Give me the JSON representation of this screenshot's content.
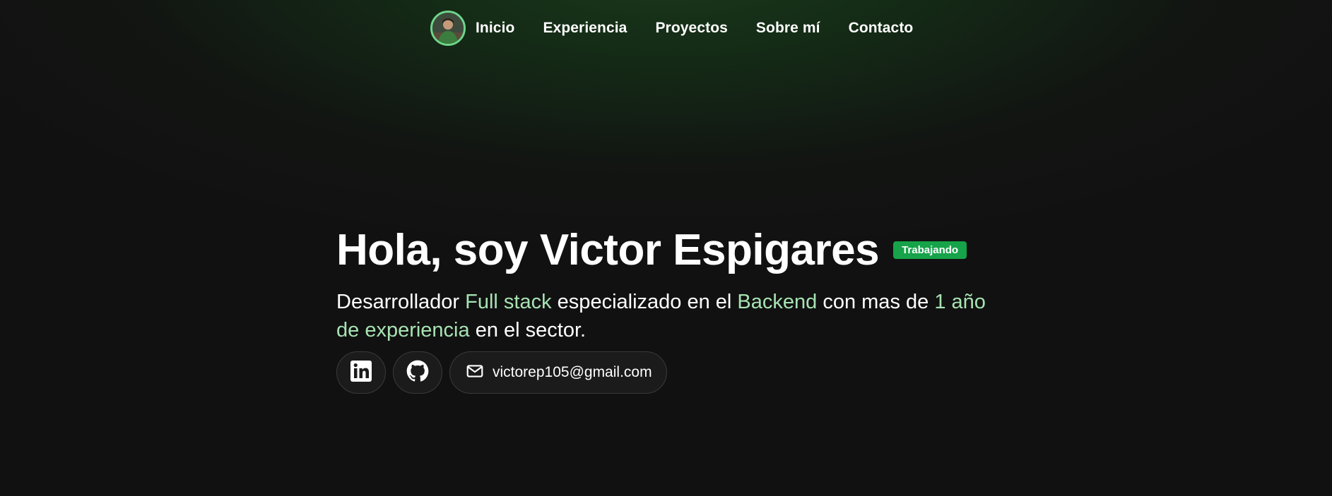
{
  "nav": {
    "items": [
      {
        "label": "Inicio"
      },
      {
        "label": "Experiencia"
      },
      {
        "label": "Proyectos"
      },
      {
        "label": "Sobre mí"
      },
      {
        "label": "Contacto"
      }
    ]
  },
  "hero": {
    "title": "Hola, soy Victor Espigares",
    "badge": "Trabajando",
    "subtitle": {
      "part1": "Desarrollador ",
      "highlight1": "Full stack",
      "part2": " especializado en el ",
      "highlight2": "Backend",
      "part3": " con mas de ",
      "highlight3": "1 año de experiencia",
      "part4": " en el sector."
    },
    "social": {
      "linkedin_icon": "linkedin-icon",
      "github_icon": "github-icon",
      "mail_icon": "mail-icon",
      "email": "victorep105@gmail.com"
    }
  },
  "colors": {
    "accent": "#a7e3b3",
    "badge": "#16a34a",
    "avatar_ring": "#6fd58a",
    "background": "#111111"
  }
}
